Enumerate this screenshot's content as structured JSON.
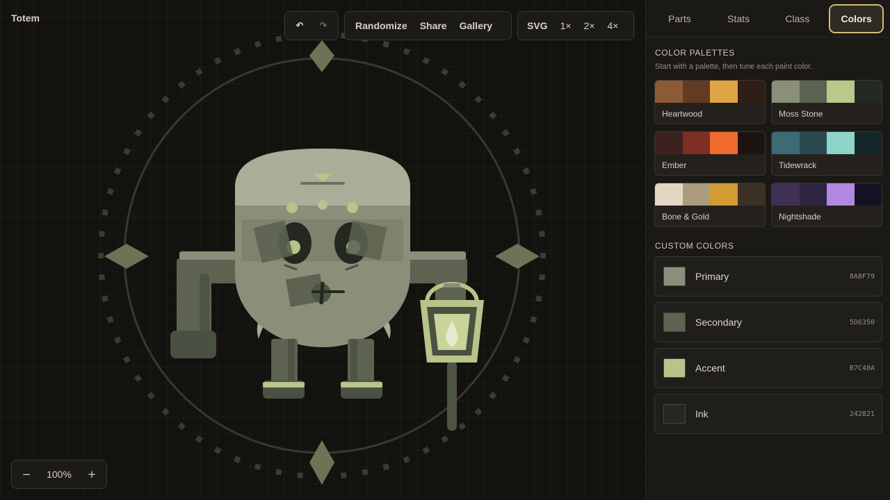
{
  "app": {
    "title": "Totem"
  },
  "toolbar": {
    "undo_icon": "undo-icon",
    "redo_icon": "redo-icon",
    "randomize_label": "Randomize",
    "share_label": "Share",
    "gallery_label": "Gallery",
    "svg_label": "SVG",
    "scale_1x": "1×",
    "scale_2x": "2×",
    "scale_4x": "4×"
  },
  "zoom": {
    "minus": "−",
    "level": "100%",
    "plus": "+"
  },
  "tabs": [
    {
      "label": "Parts",
      "active": false
    },
    {
      "label": "Stats",
      "active": false
    },
    {
      "label": "Class",
      "active": false
    },
    {
      "label": "Colors",
      "active": true
    }
  ],
  "palettes_section": {
    "title": "COLOR PALETTES",
    "subtitle": "Start with a palette, then tune each paint color.",
    "palettes": [
      {
        "name": "Heartwood",
        "colors": [
          "#8d5a36",
          "#633b22",
          "#dfa443",
          "#2e1e16"
        ]
      },
      {
        "name": "Moss Stone",
        "colors": [
          "#8a8f7a",
          "#5c6252",
          "#b8c98a",
          "#242a22"
        ]
      },
      {
        "name": "Ember",
        "colors": [
          "#3b2220",
          "#7c2f22",
          "#ee6a2d",
          "#1c1210"
        ]
      },
      {
        "name": "Tidewrack",
        "colors": [
          "#3d6b75",
          "#2a4a50",
          "#8ed3c7",
          "#14262a"
        ]
      },
      {
        "name": "Bone & Gold",
        "colors": [
          "#e3d7c3",
          "#ab9c7d",
          "#d29b34",
          "#3a3024"
        ]
      },
      {
        "name": "Nightshade",
        "colors": [
          "#3f3156",
          "#2e2441",
          "#b388e0",
          "#161224"
        ]
      }
    ]
  },
  "custom_section": {
    "title": "CUSTOM COLORS",
    "colors": [
      {
        "name": "Primary",
        "hex": "8A8F79",
        "color": "#8a8f79"
      },
      {
        "name": "Secondary",
        "hex": "5D6350",
        "color": "#5d6350"
      },
      {
        "name": "Accent",
        "hex": "B7C48A",
        "color": "#b7c48a"
      },
      {
        "name": "Ink",
        "hex": "242821",
        "color": "#242821"
      }
    ]
  }
}
